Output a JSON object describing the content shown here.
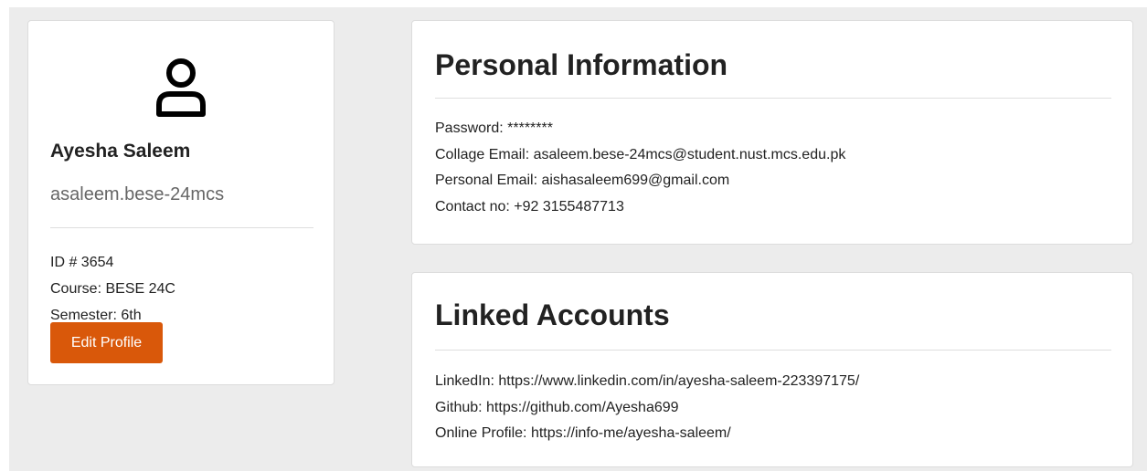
{
  "profile": {
    "avatar_icon": "user-icon",
    "name": "Ayesha Saleem",
    "username": "asaleem.bese-24mcs",
    "id_line": "ID # 3654",
    "course_line": "Course: BESE 24C",
    "semester_line": "Semester: 6th",
    "edit_label": "Edit Profile"
  },
  "personal_info": {
    "title": "Personal Information",
    "password_line": "Password: ********",
    "college_email_line": "Collage Email: asaleem.bese-24mcs@student.nust.mcs.edu.pk",
    "personal_email_line": "Personal Email: aishasaleem699@gmail.com",
    "contact_line": "Contact no: +92 3155487713"
  },
  "linked_accounts": {
    "title": "Linked Accounts",
    "linkedin_line": "LinkedIn: https://www.linkedin.com/in/ayesha-saleem-223397175/",
    "github_line": "Github: https://github.com/Ayesha699",
    "online_profile_line": "Online Profile: https://info-me/ayesha-saleem/"
  },
  "colors": {
    "accent": "#d9580a",
    "page_background": "#ececec",
    "card_background": "#ffffff"
  }
}
